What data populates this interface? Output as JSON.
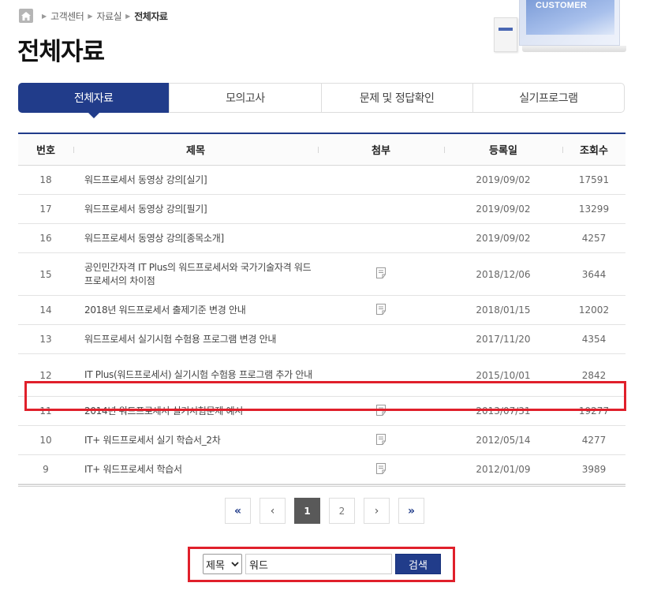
{
  "colors": {
    "accent": "#213c8a",
    "highlight": "#e0202b",
    "active_page": "#595959"
  },
  "breadcrumb": {
    "home_icon": "home-icon",
    "items": [
      "고객센터",
      "자료실"
    ],
    "current": "전체자료"
  },
  "page_title": "전체자료",
  "promo": {
    "text": "CUSTOMER"
  },
  "tabs": [
    {
      "label": "전체자료",
      "active": true
    },
    {
      "label": "모의고사",
      "active": false
    },
    {
      "label": "문제 및 정답확인",
      "active": false
    },
    {
      "label": "실기프로그램",
      "active": false
    }
  ],
  "table": {
    "headers": {
      "num": "번호",
      "title": "제목",
      "attach": "첨부",
      "date": "등록일",
      "views": "조회수"
    },
    "rows": [
      {
        "num": "18",
        "title": "워드프로세서 동영상 강의[실기]",
        "attach": false,
        "date": "2019/09/02",
        "views": "17591"
      },
      {
        "num": "17",
        "title": "워드프로세서 동영상 강의[필기]",
        "attach": false,
        "date": "2019/09/02",
        "views": "13299"
      },
      {
        "num": "16",
        "title": "워드프로세서 동영상 강의[종목소개]",
        "attach": false,
        "date": "2019/09/02",
        "views": "4257"
      },
      {
        "num": "15",
        "title": "공인민간자격 IT Plus의 워드프로세서와 국가기술자격 워드프로세서의 차이점",
        "attach": true,
        "date": "2018/12/06",
        "views": "3644"
      },
      {
        "num": "14",
        "title": "2018년 워드프로세서 출제기준 변경 안내",
        "attach": true,
        "date": "2018/01/15",
        "views": "12002"
      },
      {
        "num": "13",
        "title": "워드프로세서 실기시험 수험용 프로그램 변경 안내",
        "attach": false,
        "date": "2017/11/20",
        "views": "4354"
      },
      {
        "num": "12",
        "title": "IT Plus(워드프로세서) 실기시험 수험용 프로그램 추가 안내",
        "attach": false,
        "date": "2015/10/01",
        "views": "2842"
      },
      {
        "num": "11",
        "title": "2014년 워드프로세서 실기시험문제 예시",
        "attach": true,
        "date": "2013/07/31",
        "views": "19277"
      },
      {
        "num": "10",
        "title": "IT+ 워드프로세서 실기 학습서_2차",
        "attach": true,
        "date": "2012/05/14",
        "views": "4277"
      },
      {
        "num": "9",
        "title": "IT+ 워드프로세서 학습서",
        "attach": true,
        "date": "2012/01/09",
        "views": "3989"
      }
    ]
  },
  "pagination": {
    "first": "«",
    "prev": "‹",
    "pages": [
      "1",
      "2"
    ],
    "current": "1",
    "next": "›",
    "last": "»"
  },
  "search": {
    "field_selected": "제목",
    "query": "워드",
    "button_label": "검색"
  }
}
